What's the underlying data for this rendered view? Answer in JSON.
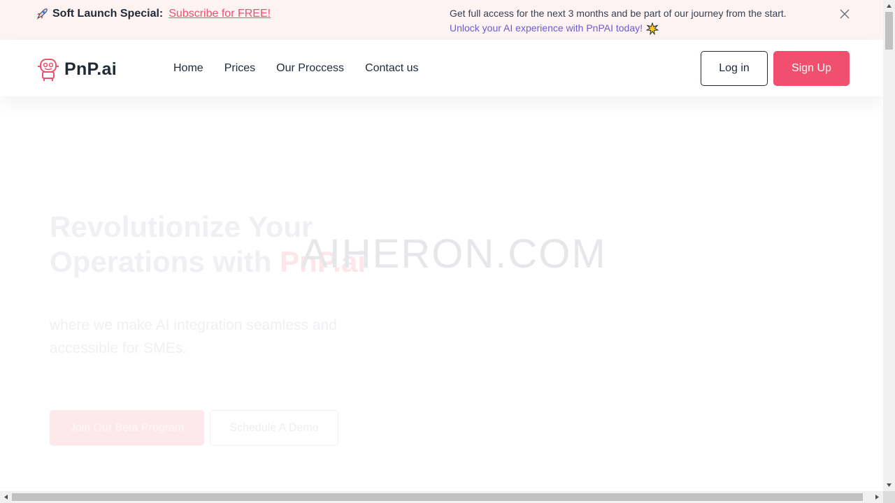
{
  "announcement": {
    "label": "Soft Launch Special:",
    "link": "Subscribe for FREE!",
    "message_line1": "Get full access for the next 3 months and be part of our journey from the start.",
    "message_line2": "Unlock your AI experience with PnPAI today!",
    "rocket_icon": "rocket-icon",
    "spark_icon": "sparkle-icon",
    "close_icon": "close-icon"
  },
  "brand": {
    "name": "PnP.ai",
    "logo_icon": "robot-logo-icon"
  },
  "nav": {
    "items": [
      "Home",
      "Prices",
      "Our Proccess",
      "Contact us"
    ]
  },
  "auth": {
    "login": "Log in",
    "signup": "Sign Up"
  },
  "hero": {
    "title_line1": "Revolutionize Your",
    "title_line2_prefix": "Operations with",
    "title_accent": "PnP.ai",
    "subtitle": "where we make AI integration seamless and accessible for SMEs.",
    "primary_cta": "Join Our Beta Program",
    "secondary_cta": "Schedule A Demo"
  },
  "watermark": "AIHERON.COM",
  "colors": {
    "accent": "#f0506e",
    "announce_bg": "#fdf3f3",
    "secondary_text": "#6d5bd0"
  }
}
